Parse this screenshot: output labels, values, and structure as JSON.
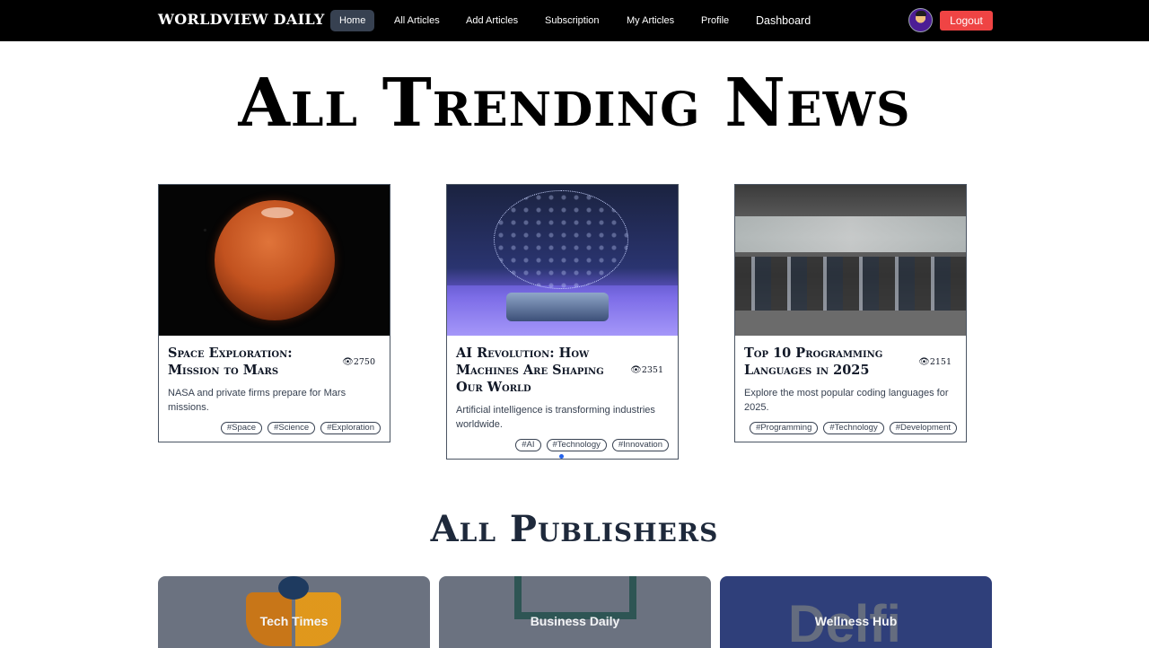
{
  "navbar": {
    "brand": "WORLDVIEW DAILY",
    "links": [
      "Home",
      "All Articles",
      "Add Articles",
      "Subscription",
      "My Articles",
      "Profile",
      "Dashboard"
    ],
    "active": "Home",
    "logout_label": "Logout",
    "avatar_icon": "user-avatar-icon"
  },
  "hero": {
    "title": "All Trending News"
  },
  "articles": [
    {
      "title": "Space Exploration: Mission to Mars",
      "views": "2750",
      "description": "NASA and private firms prepare for Mars missions.",
      "tags": [
        "#Space",
        "#Science",
        "#Exploration"
      ]
    },
    {
      "title": "AI Revolution: How Machines Are Shaping Our World",
      "views": "2351",
      "description": "Artificial intelligence is transforming industries worldwide.",
      "tags": [
        "#AI",
        "#Technology",
        "#Innovation"
      ]
    },
    {
      "title": "Top 10 Programming Languages in 2025",
      "views": "2151",
      "description": "Explore the most popular coding languages for 2025.",
      "tags": [
        "#Programming",
        "#Technology",
        "#Development"
      ]
    }
  ],
  "publishers_section": {
    "title": "All Publishers"
  },
  "publishers": [
    {
      "name": "Tech Times"
    },
    {
      "name": "Business Daily"
    },
    {
      "name": "Wellness Hub"
    }
  ],
  "colors": {
    "navbar_bg": "#000000",
    "logout_bg": "#ef4444",
    "active_link_bg": "#374151",
    "publisher_blue": "#2f3f7a"
  }
}
